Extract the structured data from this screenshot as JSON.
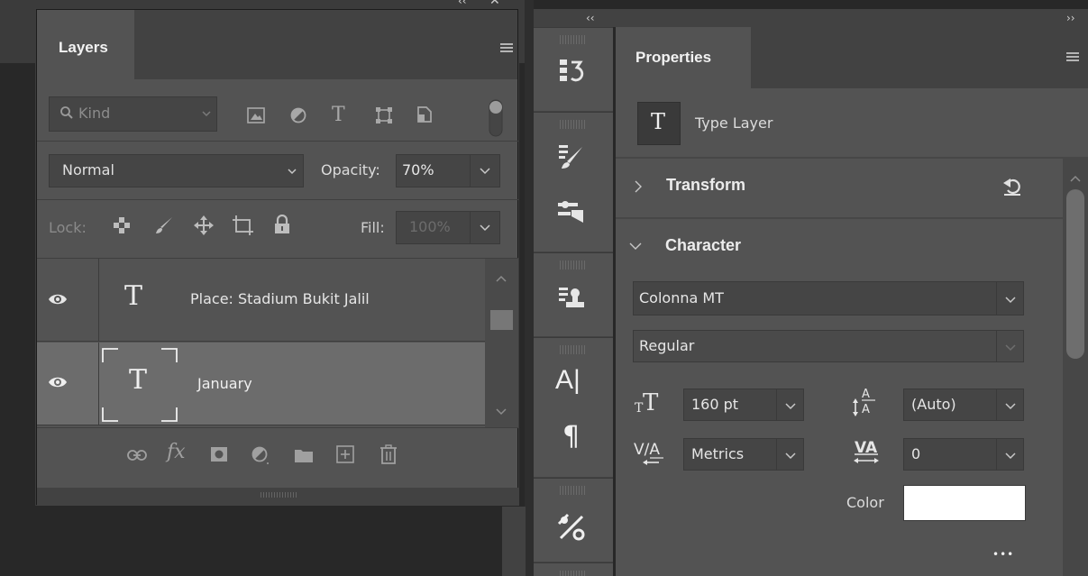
{
  "topbar": {
    "collapse_left": "‹‹",
    "collapse_right": "››",
    "close_glyph": "✕",
    "collapse_small": "‹‹"
  },
  "layers": {
    "tab_title": "Layers",
    "filter": {
      "placeholder": "Kind"
    },
    "blend_mode": "Normal",
    "opacity_label": "Opacity:",
    "opacity_value": "70%",
    "lock_label": "Lock:",
    "fill_label": "Fill:",
    "fill_value": "100%",
    "items": [
      {
        "name": "Place: Stadium Bukit Jalil",
        "type_glyph": "T",
        "visible": true,
        "selected": false
      },
      {
        "name": "January",
        "type_glyph": "T",
        "visible": true,
        "selected": true
      }
    ],
    "footer_icons": [
      "link-icon",
      "fx-icon",
      "mask-icon",
      "adjustment-icon",
      "folder-icon",
      "new-layer-icon",
      "trash-icon"
    ],
    "fx_label": "fx"
  },
  "properties": {
    "tab_title": "Properties",
    "layer_kind_glyph": "T",
    "layer_kind": "Type Layer",
    "transform_label": "Transform",
    "character_label": "Character",
    "font_family": "Colonna MT",
    "font_style": "Regular",
    "font_size": "160 pt",
    "leading": "(Auto)",
    "kerning": "Metrics",
    "tracking": "0",
    "color_label": "Color",
    "color_value": "#ffffff",
    "more_glyph": "•••"
  },
  "colors": {
    "panel_bg": "#535353",
    "tab_bar_bg": "#424242",
    "field_bg": "#454545",
    "selected_row_bg": "#6c6c6c",
    "text": "#dcdcdc"
  }
}
